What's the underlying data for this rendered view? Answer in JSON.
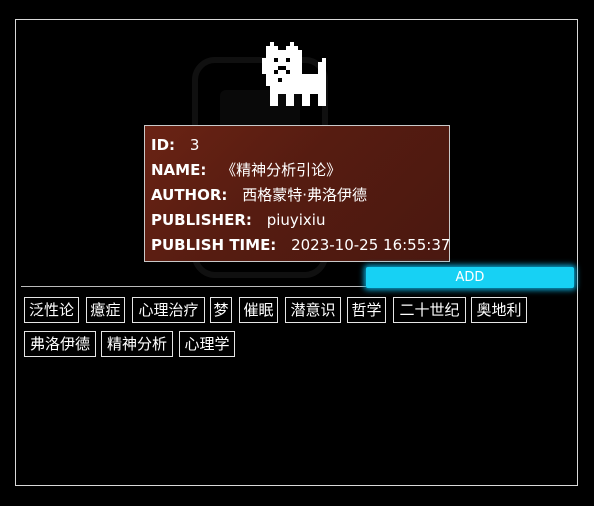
{
  "record": {
    "id_label": "ID:",
    "id_value": "3",
    "name_label": "NAME:",
    "name_value": "《精神分析引论》",
    "author_label": "AUTHOR:",
    "author_value": "西格蒙特·弗洛伊德",
    "publisher_label": "PUBLISHER:",
    "publisher_value": "piuyixiu",
    "publish_time_label": "PUBLISH TIME:",
    "publish_time_value": "2023-10-25 16:55:37"
  },
  "add_button_label": "ADD",
  "tags": [
    "泛性论",
    "癔症",
    "心理治疗",
    "梦",
    "催眠",
    "潜意识",
    "哲学",
    "二十世纪",
    "奥地利",
    "弗洛伊德",
    "精神分析",
    "心理学"
  ],
  "colors": {
    "background": "#000000",
    "tooltip_bg": "#561c11",
    "accent": "#17d1f4"
  },
  "icons": {
    "mascot": "pixel-white-dog-icon"
  }
}
